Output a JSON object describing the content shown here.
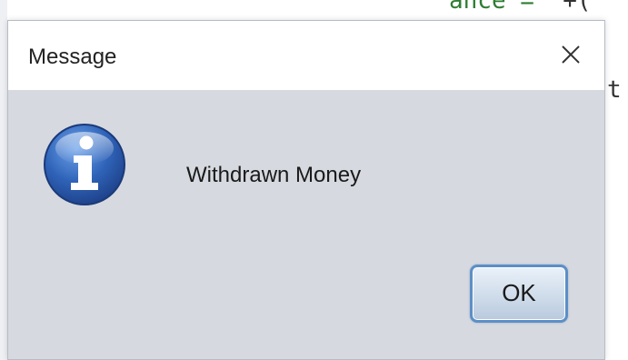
{
  "dialog": {
    "title": "Message",
    "message": "Withdrawn Money",
    "ok_label": "OK",
    "icon": "info-icon",
    "close_icon": "close-icon"
  },
  "background": {
    "code_line_1_green": "ance =",
    "code_line_1_dark": "' +(",
    "code_line_2": "t"
  },
  "colors": {
    "dialog_bg": "#d6d9df",
    "titlebar_bg": "#ffffff",
    "button_border": "#5b8fc7",
    "icon_blue": "#2f63b8"
  }
}
